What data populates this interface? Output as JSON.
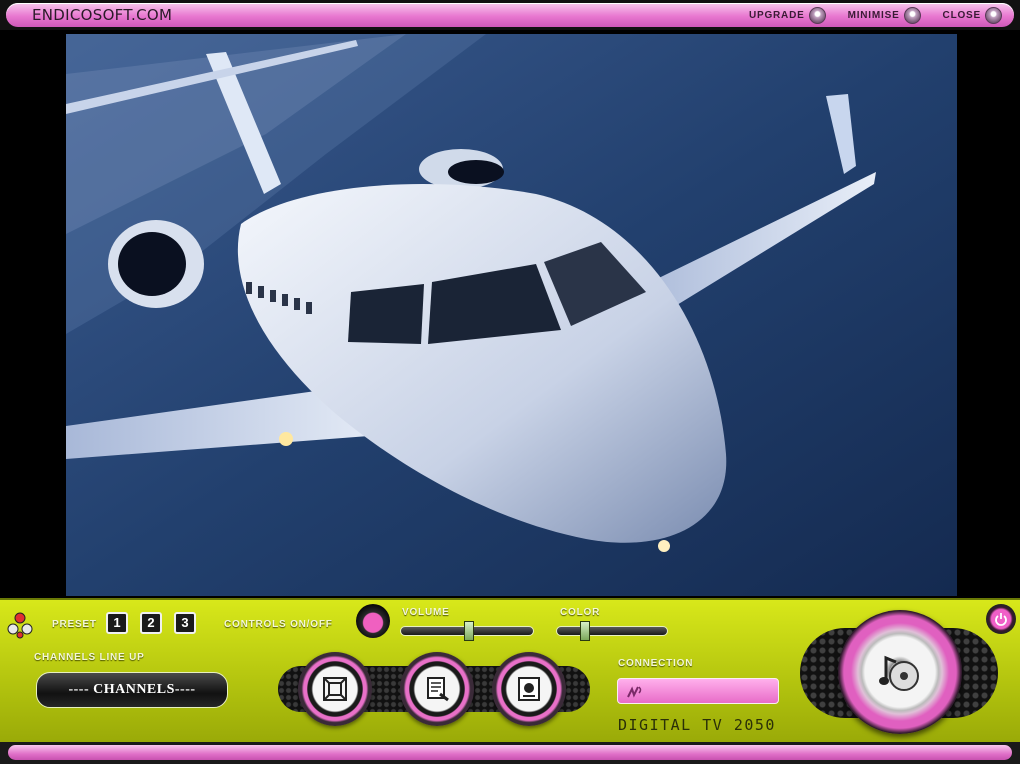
{
  "window": {
    "brand": "ENDICOSOFT.COM",
    "controls": {
      "upgrade": "UPGRADE",
      "minimise": "MINIMISE",
      "close": "CLOSE"
    }
  },
  "video": {
    "content": "jet-aircraft-over-sea"
  },
  "panel": {
    "preset_label": "PRESET",
    "presets": [
      "1",
      "2",
      "3"
    ],
    "controls_toggle_label": "CONTROLS ON/OFF",
    "volume_label": "VOLUME",
    "volume_level": 0.52,
    "color_label": "COLOR",
    "color_level": 0.24,
    "channels_lineup_label": "CHANNELS LINE UP",
    "channels_button": "---- CHANNELS----",
    "connection_label": "CONNECTION",
    "product_name": "DIGITAL TV 2050"
  },
  "icons": {
    "nav": "navigation-arrows-icon",
    "fullscreen": "fullscreen-icon",
    "guide": "program-guide-icon",
    "record": "record-icon",
    "connection": "signal-icon",
    "dial": "music-disc-icon",
    "power": "power-icon"
  },
  "colors": {
    "pink_accent": "#e878d0",
    "panel_green": "#c6d614",
    "dark": "#111111"
  }
}
